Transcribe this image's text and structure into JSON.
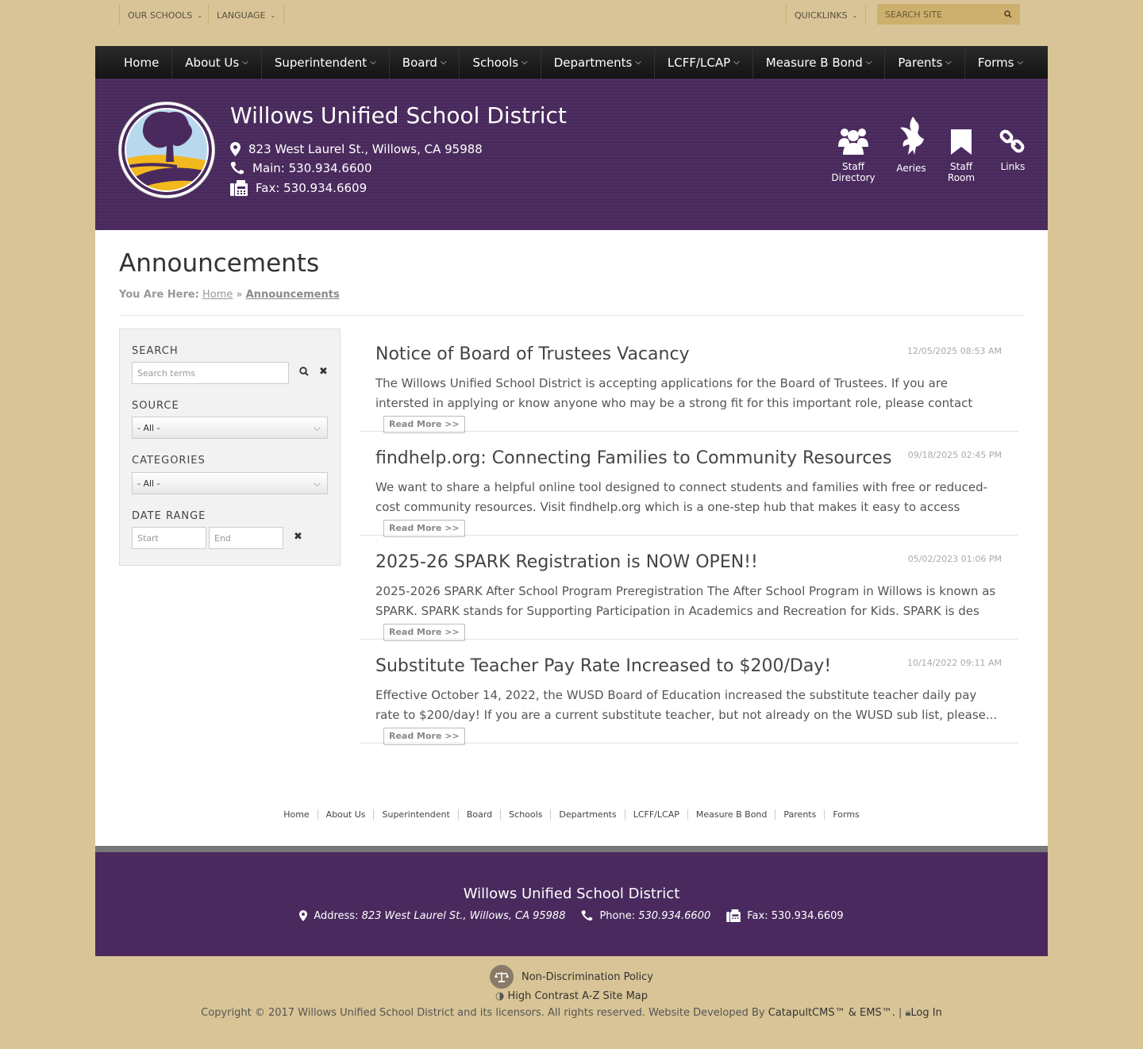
{
  "utility": {
    "our_schools": "OUR SCHOOLS",
    "language": "LANGUAGE",
    "quicklinks": "QUICKLINKS",
    "search_placeholder": "SEARCH SITE"
  },
  "nav": [
    {
      "label": "Home",
      "has_menu": false
    },
    {
      "label": "About Us",
      "has_menu": true
    },
    {
      "label": "Superintendent",
      "has_menu": true
    },
    {
      "label": "Board",
      "has_menu": true
    },
    {
      "label": "Schools",
      "has_menu": true
    },
    {
      "label": "Departments",
      "has_menu": true
    },
    {
      "label": "LCFF/LCAP",
      "has_menu": true
    },
    {
      "label": "Measure B Bond",
      "has_menu": true
    },
    {
      "label": "Parents",
      "has_menu": true
    },
    {
      "label": "Forms",
      "has_menu": true
    }
  ],
  "header": {
    "title": "Willows Unified School District",
    "address": "823 West Laurel St., Willows, CA 95988",
    "main_phone": "Main: 530.934.6600",
    "fax": "Fax: 530.934.6609",
    "quick_icons": [
      {
        "label": "Staff Directory",
        "icon": "users-icon"
      },
      {
        "label": "Aeries",
        "icon": "eagle-icon"
      },
      {
        "label": "Staff Room",
        "icon": "bookmark-icon"
      },
      {
        "label": "Links",
        "icon": "link-icon"
      }
    ]
  },
  "page": {
    "title": "Announcements",
    "crumb_label": "You Are Here:",
    "crumb_home": "Home",
    "crumb_current": "Announcements"
  },
  "filters": {
    "search_label": "SEARCH",
    "search_placeholder": "Search terms",
    "source_label": "SOURCE",
    "source_value": "- All -",
    "categories_label": "CATEGORIES",
    "categories_value": "- All -",
    "date_label": "DATE RANGE",
    "start_placeholder": "Start",
    "end_placeholder": "End"
  },
  "announcements": [
    {
      "title": "Notice of Board of Trustees Vacancy",
      "date": "12/05/2025 08:53 AM",
      "body": "The Willows Unified School District is accepting applications for the Board of Trustees. If you are intersted in applying or know anyone who may be a strong fit for this important role, please contact",
      "read_more": "Read More >>"
    },
    {
      "title": "findhelp.org: Connecting Families to Community Resources",
      "date": "09/18/2025 02:45 PM",
      "body": "We want to share a helpful online tool designed to connect students and families with free or reduced-cost community resources. Visit findhelp.org which is a one-step hub that makes it easy to access",
      "read_more": "Read More >>"
    },
    {
      "title": "2025-26 SPARK Registration is NOW OPEN!!",
      "date": "05/02/2023 01:06 PM",
      "body": "2025-2026 SPARK After School Program Preregistration The After School Program in Willows is known as SPARK. SPARK stands for Supporting Participation in Academics and Recreation for Kids. SPARK is des",
      "read_more": "Read More >>"
    },
    {
      "title": "Substitute Teacher Pay Rate Increased to $200/Day!",
      "date": "10/14/2022 09:11 AM",
      "body": "Effective October 14, 2022, the WUSD Board of Education increased the substitute teacher daily pay rate to $200/day! If you are a current substitute teacher, but not already on the WUSD sub list, please...",
      "read_more": "Read More >>"
    }
  ],
  "footer_links": [
    "Home",
    "About Us",
    "Superintendent",
    "Board",
    "Schools",
    "Departments",
    "LCFF/LCAP",
    "Measure B Bond",
    "Parents",
    "Forms"
  ],
  "footer": {
    "title": "Willows Unified School District",
    "address_label": "Address:",
    "address": "823 West Laurel St., Willows, CA 95988",
    "phone_label": "Phone:",
    "phone": "530.934.6600",
    "fax": "Fax: 530.934.6609"
  },
  "bottom": {
    "nondiscrimination": "Non-Discrimination Policy",
    "high_contrast": "High Contrast",
    "sitemap": "A-Z Site Map",
    "copyright": "Copyright © 2017 Willows Unified School District and its licensors. All rights reserved. Website Developed By",
    "developer": "CatapultCMS™ & EMS™.",
    "login": "Log In"
  },
  "colors": {
    "background": "#d8c496",
    "purple": "#4a2a5e",
    "nav": "#1c1c1c"
  }
}
